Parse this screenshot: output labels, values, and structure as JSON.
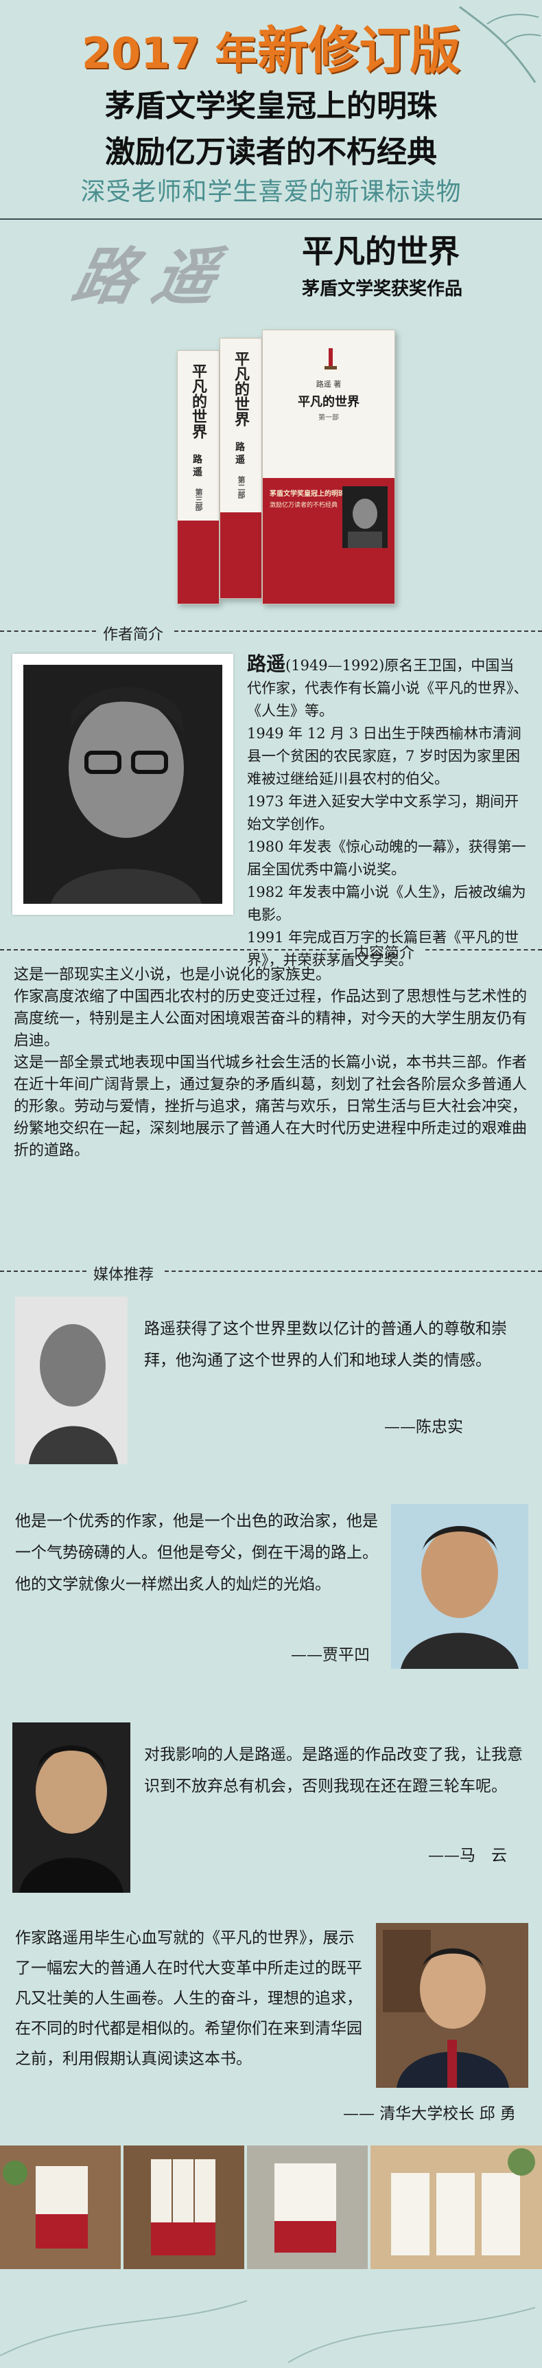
{
  "header": {
    "year": "2017 年",
    "edition": "新修订版",
    "line1": "茅盾文学奖皇冠上的明珠",
    "line2": "激励亿万读者的不朽经典",
    "line3": "深受老师和学生喜爱的新课标读物"
  },
  "book": {
    "calligraphy": "路遥",
    "title": "平凡的世界",
    "award": "茅盾文学奖获奖作品",
    "spines": [
      "平凡的世界",
      "平凡的世界",
      "平凡的世界"
    ],
    "spine_author": "路 遥",
    "volumes": [
      "第一部",
      "第二部",
      "第三部"
    ],
    "front_author": "路遥 著",
    "front_title": "平凡的世界",
    "front_volume": "第一部",
    "band_line1": "茅盾文学奖皇冠上的明珠",
    "band_line2": "激励亿万读者的不朽经典"
  },
  "author_section": {
    "heading": "作者简介",
    "name": "路遥",
    "bio": [
      "(1949—1992)原名王卫国，中国当代作家，代表作有长篇小说《平凡的世界》、《人生》等。",
      "1949 年 12 月 3 日出生于陕西榆林市清涧县一个贫困的农民家庭，7 岁时因为家里困难被过继给延川县农村的伯父。",
      "1973 年进入延安大学中文系学习，期间开始文学创作。",
      "1980 年发表《惊心动魄的一幕》，获得第一届全国优秀中篇小说奖。",
      "1982 年发表中篇小说《人生》，后被改编为电影。",
      "1991 年完成百万字的长篇巨著《平凡的世界》，并荣获茅盾文学奖。"
    ]
  },
  "content_section": {
    "heading": "内容简介",
    "paragraphs": [
      "这是一部现实主义小说，也是小说化的家族史。",
      "作家高度浓缩了中国西北农村的历史变迁过程，作品达到了思想性与艺术性的高度统一，特别是主人公面对困境艰苦奋斗的精神，对今天的大学生朋友仍有启迪。",
      "这是一部全景式地表现中国当代城乡社会生活的长篇小说，本书共三部。作者在近十年间广阔背景上，通过复杂的矛盾纠葛，刻划了社会各阶层众多普通人的形象。劳动与爱情，挫折与追求，痛苦与欢乐，日常生活与巨大社会冲突，纷繁地交织在一起，深刻地展示了普通人在大时代历史进程中所走过的艰难曲折的道路。"
    ]
  },
  "media_section": {
    "heading": "媒体推荐",
    "reviews": [
      {
        "quote": "路遥获得了这个世界里数以亿计的普通人的尊敬和崇拜，他沟通了这个世界的人们和地球人类的情感。",
        "sign": "——陈忠实"
      },
      {
        "quote": "他是一个优秀的作家，他是一个出色的政治家，他是一个气势磅礴的人。但他是夸父，倒在干渴的路上。他的文学就像火一样燃出炙人的灿烂的光焰。",
        "sign": "——贾平凹"
      },
      {
        "quote": "对我影响的人是路遥。是路遥的作品改变了我，让我意识到不放弃总有机会，否则我现在还在蹬三轮车呢。",
        "sign": "——马　云"
      },
      {
        "quote": "作家路遥用毕生心血写就的《平凡的世界》，展示了一幅宏大的普通人在时代大变革中所走过的既平凡又壮美的人生画卷。人生的奋斗，理想的追求，在不同的时代都是相似的。希望你们在来到清华园之前，利用假期认真阅读这本书。",
        "sign": "——  清华大学校长  邱  勇"
      }
    ]
  },
  "colors": {
    "background": "#cfe4e1",
    "year_orange": "#e7781f",
    "subtitle_teal": "#4b8f90",
    "book_red": "#b01e2a"
  }
}
